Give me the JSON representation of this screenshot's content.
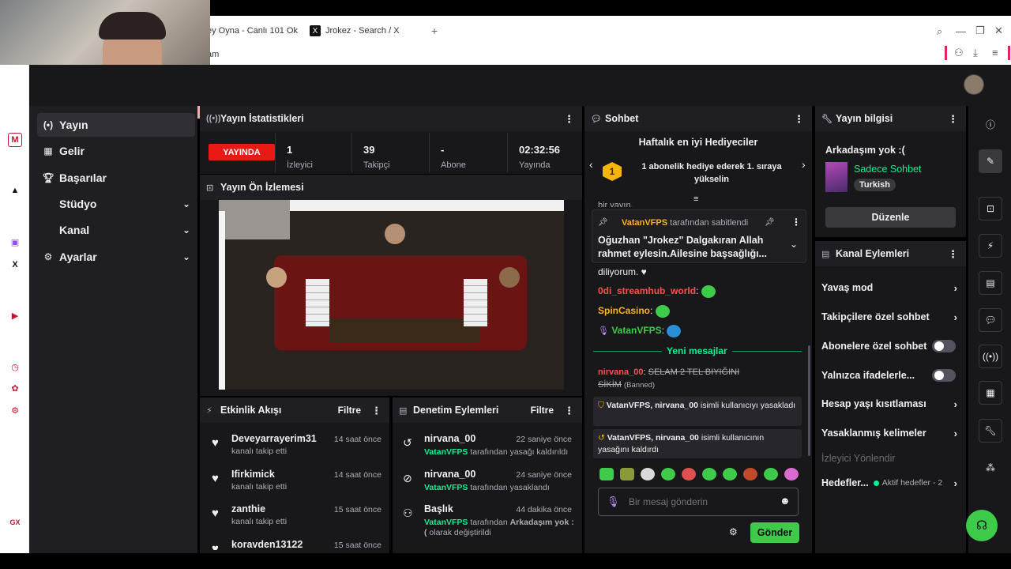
{
  "browser": {
    "tabs": [
      {
        "title": "ey Oyna - Canlı 101 Ok"
      },
      {
        "title": "Jrokez - Search / X"
      }
    ],
    "address_fragment": "am",
    "new_tab_label": "+"
  },
  "nav": {
    "items": [
      {
        "label": "Yayın",
        "icon": "broadcast-icon",
        "active": true
      },
      {
        "label": "Gelir",
        "icon": "revenue-icon"
      },
      {
        "label": "Başarılar",
        "icon": "trophy-icon"
      },
      {
        "label": "Stüdyo",
        "icon": "studio-icon",
        "expandable": true
      },
      {
        "label": "Kanal",
        "icon": "channel-icon",
        "expandable": true
      },
      {
        "label": "Ayarlar",
        "icon": "gear-icon",
        "expandable": true
      }
    ]
  },
  "stats": {
    "title": "Yayın İstatistikleri",
    "live_badge": "YAYINDA",
    "viewers": {
      "value": "1",
      "label": "İzleyici"
    },
    "followers": {
      "value": "39",
      "label": "Takipçi"
    },
    "subs": {
      "value": "-",
      "label": "Abone"
    },
    "uptime": {
      "value": "02:32:56",
      "label": "Yayında"
    }
  },
  "preview": {
    "title": "Yayın Ön İzlemesi"
  },
  "activity": {
    "title": "Etkinlik Akışı",
    "filter_label": "Filtre",
    "items": [
      {
        "name": "Deveyarrayerim31",
        "sub": "kanalı takip etti",
        "time": "14 saat önce"
      },
      {
        "name": "Ifirkimick",
        "sub": "kanalı takip etti",
        "time": "14 saat önce"
      },
      {
        "name": "zanthie",
        "sub": "kanalı takip etti",
        "time": "15 saat önce"
      },
      {
        "name": "koravden13122",
        "sub": "",
        "time": "15 saat önce"
      }
    ]
  },
  "moderation": {
    "title": "Denetim Eylemleri",
    "filter_label": "Filtre",
    "items": [
      {
        "name": "nirvana_00",
        "actor": "VatanVFPS",
        "action": "tarafından yasağı kaldırıldı",
        "time": "22 saniye önce",
        "icon": "unban-icon"
      },
      {
        "name": "nirvana_00",
        "actor": "VatanVFPS",
        "action": "tarafından yasaklandı",
        "time": "24 saniye önce",
        "icon": "ban-icon"
      },
      {
        "name": "Başlık",
        "actor": "VatanVFPS",
        "action": "tarafından",
        "extra": "Arkadaşım yok : (",
        "tail": "olarak değiştirildi",
        "time": "44 dakika önce",
        "icon": "title-change-icon"
      }
    ]
  },
  "chat": {
    "title": "Sohbet",
    "leaderboard_title": "Haftalık en iyi Hediyeciler",
    "leaderboard_rank": "1",
    "leaderboard_text": "1 abonelik hediye ederek 1. sıraya yükselin",
    "partial_top": "bir yayın.",
    "pinned_by_user": "VatanVFPS",
    "pinned_by_text": "tarafından sabitlendi",
    "pinned_message": "Oğuzhan \"Jrokez\" Dalgakıran Allah rahmet eylesin.Ailesine başsağlığı...",
    "continued_text": "diliyorum. ♥",
    "messages": [
      {
        "user": "0di_streamhub_world",
        "color": "#ff4f4d"
      },
      {
        "user": "SpinCasino",
        "color": "#ffb31a"
      },
      {
        "user": "VatanVFPS",
        "color": "#3fcb4a"
      }
    ],
    "new_messages_label": "Yeni mesajlar",
    "deleted_user": "nirvana_00",
    "deleted_text": "SELAM 2 TEL BIYIĞINI SİKİM",
    "banned_tag": "(Banned)",
    "system_1_actor": "VatanVFPS,",
    "system_1_target": "nirvana_00",
    "system_1_text": "isimli kullanıcıyı yasakladı",
    "system_2_actor": "VatanVFPS,",
    "system_2_target": "nirvana_00",
    "system_2_text": "isimli kullanıcının yasağını kaldırdı",
    "input_placeholder": "Bir mesaj gönderin",
    "send_label": "Gönder"
  },
  "stream_info": {
    "title": "Yayın bilgisi",
    "stream_title": "Arkadaşım yok :(",
    "category": "Sadece Sohbet",
    "tag": "Turkish",
    "edit_label": "Düzenle"
  },
  "channel_actions": {
    "title": "Kanal Eylemleri",
    "items": [
      {
        "label": "Yavaş mod",
        "type": "arrow"
      },
      {
        "label": "Takipçilere özel sohbet",
        "type": "arrow"
      },
      {
        "label": "Abonelere özel sohbet",
        "type": "toggle"
      },
      {
        "label": "Yalnızca ifadelerle...",
        "type": "toggle"
      },
      {
        "label": "Hesap yaşı kısıtlaması",
        "type": "arrow"
      },
      {
        "label": "Yasaklanmış kelimeler",
        "type": "arrow"
      }
    ],
    "disabled_label": "İzleyici Yönlendir",
    "goals_label": "Hedefler...",
    "goals_status": "Aktif hedefler - 2"
  },
  "opera": {
    "brand": "GX"
  },
  "colors": {
    "accent": "#00f593",
    "live": "#e91916",
    "send": "#3fcb4a"
  }
}
